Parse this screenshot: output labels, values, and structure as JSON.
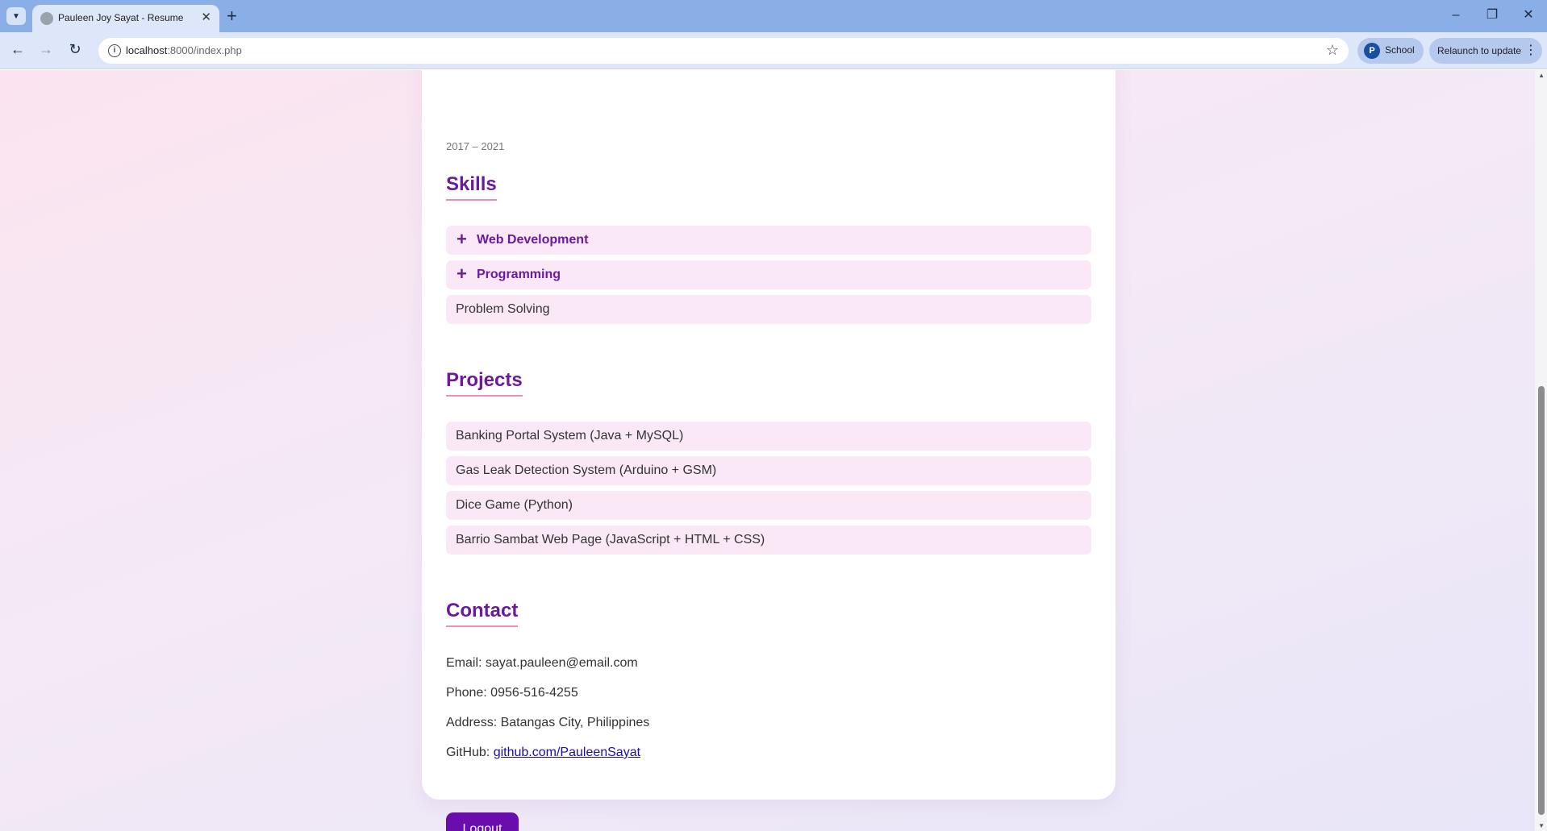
{
  "browser": {
    "tab_title": "Pauleen Joy Sayat - Resume",
    "url_host": "localhost",
    "url_rest": ":8000/index.php",
    "profile_initial": "P",
    "profile_name": "School",
    "relaunch_label": "Relaunch to update"
  },
  "resume": {
    "education_dates": "2017 – 2021",
    "skills": {
      "title": "Skills",
      "items": [
        {
          "label": "Web Development",
          "expandable": true
        },
        {
          "label": "Programming",
          "expandable": true
        },
        {
          "label": "Problem Solving",
          "expandable": false
        }
      ]
    },
    "projects": {
      "title": "Projects",
      "items": [
        "Banking Portal System (Java + MySQL)",
        "Gas Leak Detection System (Arduino + GSM)",
        "Dice Game (Python)",
        "Barrio Sambat Web Page (JavaScript + HTML + CSS)"
      ]
    },
    "contact": {
      "title": "Contact",
      "email_label": "Email:",
      "email": "sayat.pauleen@email.com",
      "phone_label": "Phone:",
      "phone": "0956-516-4255",
      "address_label": "Address:",
      "address": "Batangas City, Philippines",
      "github_label": "GitHub:",
      "github": "github.com/PauleenSayat"
    },
    "logout_label": "Logout"
  },
  "colors": {
    "accent": "#6a1b9a",
    "button": "#6a0dad",
    "item_bg": "#fbe8f7",
    "underline": "#f08db6"
  }
}
